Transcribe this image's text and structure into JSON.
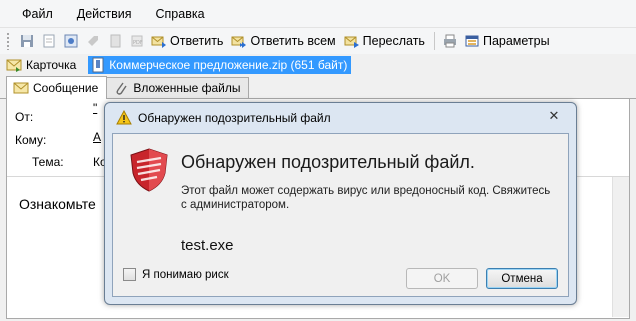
{
  "menu": [
    "Файл",
    "Действия",
    "Справка"
  ],
  "toolbar": {
    "reply": "Ответить",
    "reply_all": "Ответить всем",
    "forward": "Переслать",
    "settings": "Параметры"
  },
  "attachments": {
    "card_label": "Карточка",
    "file_label": "Коммерческое предложение.zip (651 байт)"
  },
  "tabs": {
    "message": "Сообщение",
    "attached_files": "Вложенные файлы"
  },
  "message": {
    "from_label": "От:",
    "from_value": "\"",
    "to_label": "Кому:",
    "to_value": "А",
    "subject_label": "Тема:",
    "subject_value": "Ко",
    "body_preview": "Ознакомьте"
  },
  "dialog": {
    "title": "Обнаружен подозрительный файл",
    "heading": "Обнаружен подозрительный файл.",
    "message": "Этот файл может содержать вирус или вредоносный код. Свяжитесь с администратором.",
    "filename": "test.exe",
    "checkbox_label": "Я понимаю риск",
    "ok": "OK",
    "cancel": "Отмена"
  },
  "colors": {
    "selection": "#3399ff",
    "shield_red": "#c8252c",
    "dialog_frame": "#dce6f2"
  }
}
